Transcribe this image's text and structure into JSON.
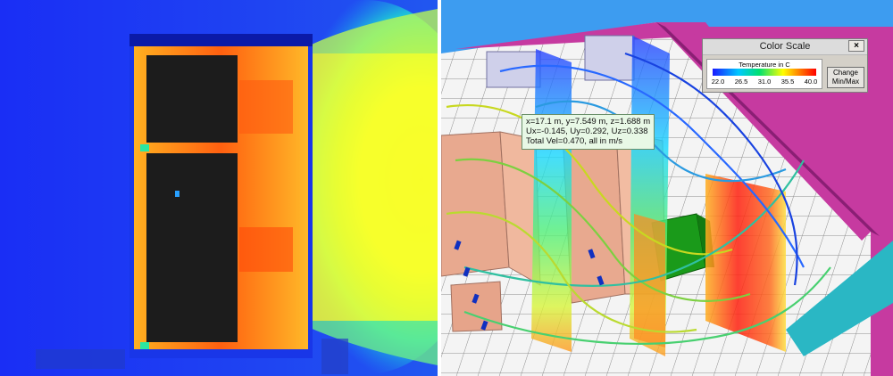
{
  "probe": {
    "line1": "x=17.1 m, y=7.549 m, z=1.688 m",
    "line2": "Ux=-0.145, Uy=0.292, Uz=0.338",
    "line3": "Total Vel=0.470, all in m/s"
  },
  "color_scale": {
    "window_title": "Color Scale",
    "close_glyph": "×",
    "caption": "Temperature in C",
    "ticks": [
      "22.0",
      "26.5",
      "31.0",
      "35.5",
      "40.0"
    ],
    "button_line1": "Change",
    "button_line2": "Min/Max",
    "gradient_colors": [
      "#1a1aff",
      "#00c8ff",
      "#00e070",
      "#ffff00",
      "#ff8c00",
      "#ff0000"
    ]
  },
  "colors": {
    "room_floor": "#f2f2f2",
    "room_walls": "#c63aa0",
    "cabinet": "#e8a98f",
    "crac_unit": "#1a9a1a",
    "cold_field": "#2a3cf6",
    "hot_field": "#ffe626"
  }
}
